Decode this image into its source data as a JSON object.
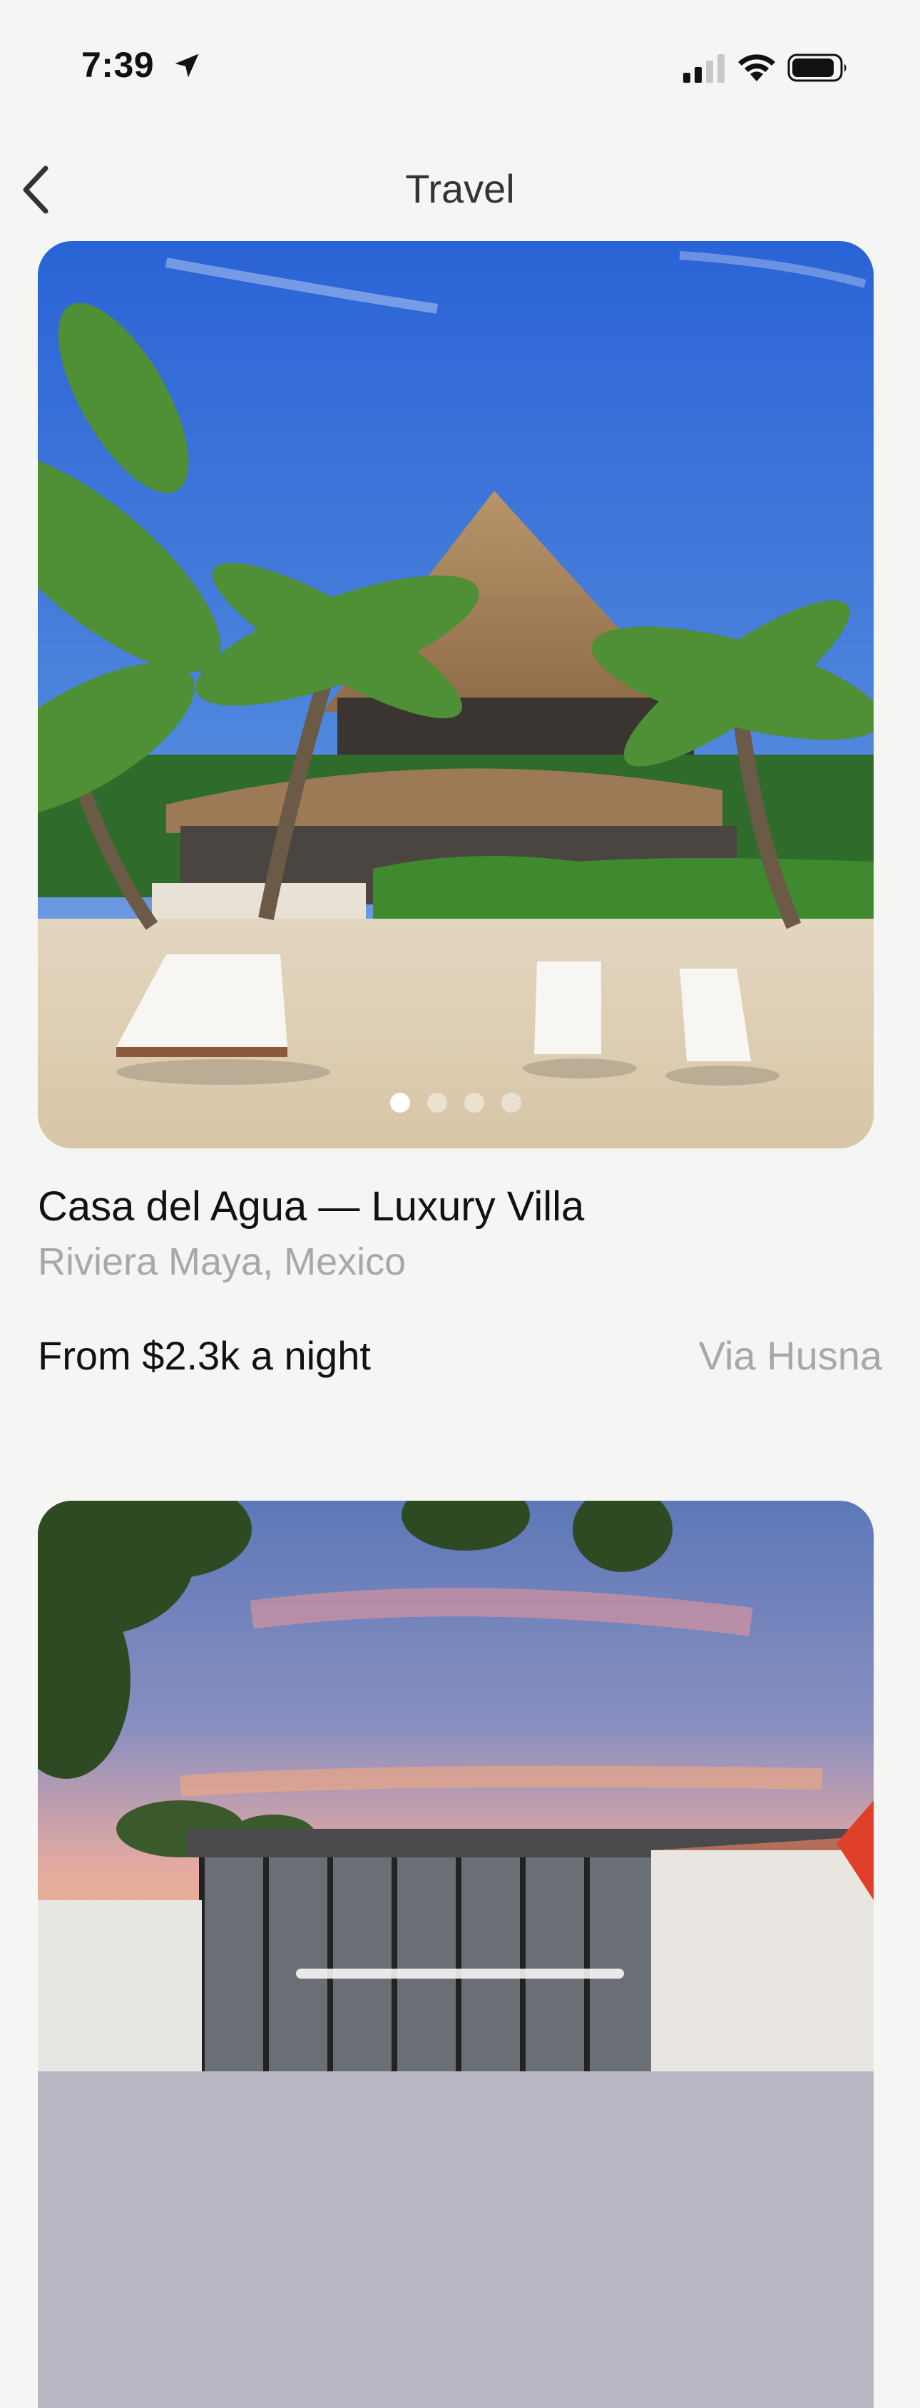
{
  "status_bar": {
    "time": "7:39"
  },
  "nav": {
    "title": "Travel"
  },
  "listings": [
    {
      "title": "Casa del Agua — Luxury Villa",
      "location": "Riviera Maya, Mexico",
      "price": "From $2.3k a night",
      "via": "Via Husna",
      "photo_count": 4,
      "active_photo": 1
    },
    {
      "title": "",
      "location": "",
      "price": "",
      "via": ""
    }
  ]
}
